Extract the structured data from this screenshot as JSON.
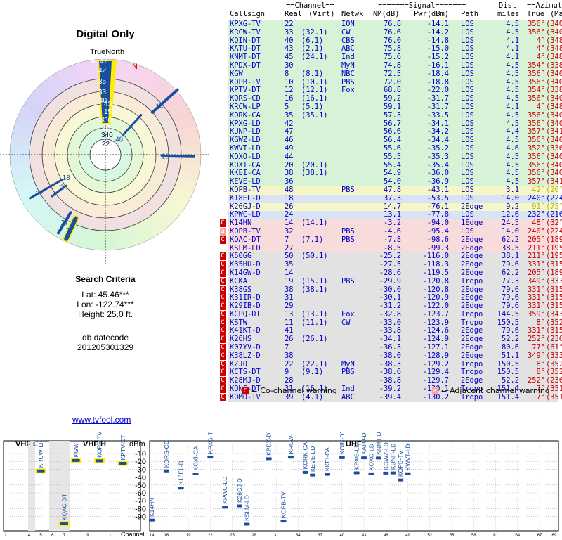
{
  "title": "Digital Only",
  "true_north_label": "TrueNorth",
  "magnetic_north_label": "N",
  "criteria": {
    "heading": "Search Criteria",
    "lat": "Lat: 45.46***",
    "lon": "Lon: -122.74***",
    "height": "Height: 25.0 ft.",
    "db_label": "db datecode",
    "db_value": "201205301329"
  },
  "link": "www.tvfool.com",
  "table": {
    "group_headers": {
      "channel": "==Channel==",
      "signal": "=======Signal=======",
      "dist": "Dist",
      "azimuth": "==Azimuth=="
    },
    "col_headers": {
      "callsign": "Callsign",
      "real": "Real",
      "virt": "(Virt)",
      "netwk": "Netwk",
      "nm": "NM(dB)",
      "pwr": "Pwr(dBm)",
      "path": "Path",
      "miles": "miles",
      "true": "True",
      "magn": "(Magn)"
    },
    "rows": [
      {
        "callsign": "KPXG-TV",
        "real": "22",
        "virt": "",
        "netwk": "ION",
        "nm": "76.8",
        "pwr": "-14.1",
        "path": "LOS",
        "dist": "4.5",
        "true": "356°",
        "magn": "(340°)",
        "color": "green",
        "warn": ""
      },
      {
        "callsign": "KRCW-TV",
        "real": "33",
        "virt": "(32.1)",
        "netwk": "CW",
        "nm": "76.6",
        "pwr": "-14.2",
        "path": "LOS",
        "dist": "4.5",
        "true": "356°",
        "magn": "(340°)",
        "color": "green",
        "warn": ""
      },
      {
        "callsign": "KOIN-DT",
        "real": "40",
        "virt": "(6.1)",
        "netwk": "CBS",
        "nm": "76.0",
        "pwr": "-14.8",
        "path": "LOS",
        "dist": "4.1",
        "true": "4°",
        "magn": "(348°)",
        "color": "green",
        "warn": ""
      },
      {
        "callsign": "KATU-DT",
        "real": "43",
        "virt": "(2.1)",
        "netwk": "ABC",
        "nm": "75.8",
        "pwr": "-15.0",
        "path": "LOS",
        "dist": "4.1",
        "true": "4°",
        "magn": "(348°)",
        "color": "green",
        "warn": ""
      },
      {
        "callsign": "KNMT-DT",
        "real": "45",
        "virt": "(24.1)",
        "netwk": "Ind",
        "nm": "75.6",
        "pwr": "-15.2",
        "path": "LOS",
        "dist": "4.1",
        "true": "4°",
        "magn": "(348°)",
        "color": "green",
        "warn": ""
      },
      {
        "callsign": "KPDX-DT",
        "real": "30",
        "virt": "",
        "netwk": "MyN",
        "nm": "74.8",
        "pwr": "-16.1",
        "path": "LOS",
        "dist": "4.5",
        "true": "354°",
        "magn": "(338°)",
        "color": "green",
        "warn": ""
      },
      {
        "callsign": "KGW",
        "real": "8",
        "virt": "(8.1)",
        "netwk": "NBC",
        "nm": "72.5",
        "pwr": "-18.4",
        "path": "LOS",
        "dist": "4.5",
        "true": "356°",
        "magn": "(340°)",
        "color": "green",
        "warn": ""
      },
      {
        "callsign": "KOPB-TV",
        "real": "10",
        "virt": "(10.1)",
        "netwk": "PBS",
        "nm": "72.0",
        "pwr": "-18.8",
        "path": "LOS",
        "dist": "4.5",
        "true": "356°",
        "magn": "(340°)",
        "color": "green",
        "warn": ""
      },
      {
        "callsign": "KPTV-DT",
        "real": "12",
        "virt": "(12.1)",
        "netwk": "Fox",
        "nm": "68.8",
        "pwr": "-22.0",
        "path": "LOS",
        "dist": "4.5",
        "true": "354°",
        "magn": "(338°)",
        "color": "green",
        "warn": ""
      },
      {
        "callsign": "KORS-CD",
        "real": "16",
        "virt": "(16.1)",
        "netwk": "",
        "nm": "59.2",
        "pwr": "-31.7",
        "path": "LOS",
        "dist": "4.5",
        "true": "356°",
        "magn": "(340°)",
        "color": "green",
        "warn": ""
      },
      {
        "callsign": "KRCW-LP",
        "real": "5",
        "virt": "(5.1)",
        "netwk": "",
        "nm": "59.1",
        "pwr": "-31.7",
        "path": "LOS",
        "dist": "4.1",
        "true": "4°",
        "magn": "(348°)",
        "color": "green",
        "warn": ""
      },
      {
        "callsign": "KORK-CA",
        "real": "35",
        "virt": "(35.1)",
        "netwk": "",
        "nm": "57.3",
        "pwr": "-33.5",
        "path": "LOS",
        "dist": "4.5",
        "true": "356°",
        "magn": "(340°)",
        "color": "green",
        "warn": ""
      },
      {
        "callsign": "KPXG-LD",
        "real": "42",
        "virt": "",
        "netwk": "",
        "nm": "56.7",
        "pwr": "-34.1",
        "path": "LOS",
        "dist": "4.5",
        "true": "356°",
        "magn": "(340°)",
        "color": "green",
        "warn": ""
      },
      {
        "callsign": "KUNP-LD",
        "real": "47",
        "virt": "",
        "netwk": "",
        "nm": "56.6",
        "pwr": "-34.2",
        "path": "LOS",
        "dist": "4.4",
        "true": "357°",
        "magn": "(341°)",
        "color": "green",
        "warn": ""
      },
      {
        "callsign": "KGWZ-LD",
        "real": "46",
        "virt": "",
        "netwk": "",
        "nm": "56.4",
        "pwr": "-34.4",
        "path": "LOS",
        "dist": "4.5",
        "true": "356°",
        "magn": "(340°)",
        "color": "green",
        "warn": ""
      },
      {
        "callsign": "KWVT-LD",
        "real": "49",
        "virt": "",
        "netwk": "",
        "nm": "55.6",
        "pwr": "-35.2",
        "path": "LOS",
        "dist": "4.6",
        "true": "352°",
        "magn": "(336°)",
        "color": "green",
        "warn": ""
      },
      {
        "callsign": "KOXO-LD",
        "real": "44",
        "virt": "",
        "netwk": "",
        "nm": "55.5",
        "pwr": "-35.3",
        "path": "LOS",
        "dist": "4.5",
        "true": "356°",
        "magn": "(340°)",
        "color": "green",
        "warn": ""
      },
      {
        "callsign": "KOXI-CA",
        "real": "20",
        "virt": "(20.1)",
        "netwk": "",
        "nm": "55.4",
        "pwr": "-35.4",
        "path": "LOS",
        "dist": "4.5",
        "true": "356°",
        "magn": "(340°)",
        "color": "green",
        "warn": ""
      },
      {
        "callsign": "KKEI-CA",
        "real": "38",
        "virt": "(38.1)",
        "netwk": "",
        "nm": "54.9",
        "pwr": "-36.0",
        "path": "LOS",
        "dist": "4.5",
        "true": "356°",
        "magn": "(340°)",
        "color": "green",
        "warn": ""
      },
      {
        "callsign": "KEVE-LD",
        "real": "36",
        "virt": "",
        "netwk": "",
        "nm": "54.0",
        "pwr": "-36.9",
        "path": "LOS",
        "dist": "4.5",
        "true": "357°",
        "magn": "(341°)",
        "color": "green",
        "warn": ""
      },
      {
        "callsign": "KOPB-TV",
        "real": "48",
        "virt": "",
        "netwk": "PBS",
        "nm": "47.8",
        "pwr": "-43.1",
        "path": "LOS",
        "dist": "3.1",
        "true": "42°",
        "magn": "(26°)",
        "color": "yellow",
        "warn": ""
      },
      {
        "callsign": "K18EL-D",
        "real": "18",
        "virt": "",
        "netwk": "",
        "nm": "37.3",
        "pwr": "-53.5",
        "path": "LOS",
        "dist": "14.0",
        "true": "240°",
        "magn": "(224°)",
        "color": "blue",
        "warn": ""
      },
      {
        "callsign": "K26GJ-D",
        "real": "26",
        "virt": "",
        "netwk": "",
        "nm": "14.7",
        "pwr": "-76.1",
        "path": "2Edge",
        "dist": "9.2",
        "true": "91°",
        "magn": "(75°)",
        "color": "yellow",
        "warn": ""
      },
      {
        "callsign": "KPWC-LD",
        "real": "24",
        "virt": "",
        "netwk": "",
        "nm": "13.1",
        "pwr": "-77.8",
        "path": "LOS",
        "dist": "12.6",
        "true": "232°",
        "magn": "(216°)",
        "color": "blue",
        "warn": ""
      },
      {
        "callsign": "K14HN",
        "real": "14",
        "virt": "(14.1)",
        "netwk": "",
        "nm": "-3.2",
        "pwr": "-94.0",
        "path": "1Edge",
        "dist": "24.5",
        "true": "48°",
        "magn": "(32°)",
        "color": "pink",
        "warn": "C"
      },
      {
        "callsign": "KOPB-TV",
        "real": "32",
        "virt": "",
        "netwk": "PBS",
        "nm": "-4.6",
        "pwr": "-95.4",
        "path": "LOS",
        "dist": "14.0",
        "true": "240°",
        "magn": "(224°)",
        "color": "pink",
        "warn": "a"
      },
      {
        "callsign": "KOAC-DT",
        "real": "7",
        "virt": "(7.1)",
        "netwk": "PBS",
        "nm": "-7.8",
        "pwr": "-98.6",
        "path": "2Edge",
        "dist": "62.2",
        "true": "205°",
        "magn": "(189°)",
        "color": "pink",
        "warn": "C"
      },
      {
        "callsign": "KSLM-LD",
        "real": "27",
        "virt": "",
        "netwk": "",
        "nm": "-8.5",
        "pwr": "-99.3",
        "path": "2Edge",
        "dist": "38.5",
        "true": "211°",
        "magn": "(195°)",
        "color": "pink",
        "warn": ""
      },
      {
        "callsign": "K50GG",
        "real": "50",
        "virt": "(50.1)",
        "netwk": "",
        "nm": "-25.2",
        "pwr": "-116.0",
        "path": "2Edge",
        "dist": "38.1",
        "true": "211°",
        "magn": "(195°)",
        "color": "gray",
        "warn": "C"
      },
      {
        "callsign": "K35HU-D",
        "real": "35",
        "virt": "",
        "netwk": "",
        "nm": "-27.5",
        "pwr": "-118.3",
        "path": "2Edge",
        "dist": "79.6",
        "true": "331°",
        "magn": "(315°)",
        "color": "gray",
        "warn": "C"
      },
      {
        "callsign": "K14GW-D",
        "real": "14",
        "virt": "",
        "netwk": "",
        "nm": "-28.6",
        "pwr": "-119.5",
        "path": "2Edge",
        "dist": "62.2",
        "true": "205°",
        "magn": "(189°)",
        "color": "gray",
        "warn": "C"
      },
      {
        "callsign": "KCKA",
        "real": "19",
        "virt": "(15.1)",
        "netwk": "PBS",
        "nm": "-29.9",
        "pwr": "-120.8",
        "path": "Tropo",
        "dist": "77.3",
        "true": "349°",
        "magn": "(333°)",
        "color": "gray",
        "warn": "C"
      },
      {
        "callsign": "K38GS",
        "real": "38",
        "virt": "(38.1)",
        "netwk": "",
        "nm": "-30.0",
        "pwr": "-120.8",
        "path": "2Edge",
        "dist": "79.6",
        "true": "331°",
        "magn": "(315°)",
        "color": "gray",
        "warn": "C"
      },
      {
        "callsign": "K31IR-D",
        "real": "31",
        "virt": "",
        "netwk": "",
        "nm": "-30.1",
        "pwr": "-120.9",
        "path": "2Edge",
        "dist": "79.6",
        "true": "331°",
        "magn": "(315°)",
        "color": "gray",
        "warn": "C"
      },
      {
        "callsign": "K29IB-D",
        "real": "29",
        "virt": "",
        "netwk": "",
        "nm": "-31.2",
        "pwr": "-122.0",
        "path": "2Edge",
        "dist": "79.6",
        "true": "331°",
        "magn": "(315°)",
        "color": "gray",
        "warn": "C"
      },
      {
        "callsign": "KCPQ-DT",
        "real": "13",
        "virt": "(13.1)",
        "netwk": "Fox",
        "nm": "-32.8",
        "pwr": "-123.7",
        "path": "Tropo",
        "dist": "144.5",
        "true": "359°",
        "magn": "(343°)",
        "color": "gray",
        "warn": "C"
      },
      {
        "callsign": "KSTW",
        "real": "11",
        "virt": "(11.1)",
        "netwk": "CW",
        "nm": "-33.0",
        "pwr": "-123.9",
        "path": "Tropo",
        "dist": "150.5",
        "true": "8°",
        "magn": "(352°)",
        "color": "gray",
        "warn": "C"
      },
      {
        "callsign": "K41KT-D",
        "real": "41",
        "virt": "",
        "netwk": "",
        "nm": "-33.8",
        "pwr": "-124.6",
        "path": "2Edge",
        "dist": "79.6",
        "true": "331°",
        "magn": "(315°)",
        "color": "gray",
        "warn": "C"
      },
      {
        "callsign": "K26HS",
        "real": "26",
        "virt": "(26.1)",
        "netwk": "",
        "nm": "-34.1",
        "pwr": "-124.9",
        "path": "2Edge",
        "dist": "52.2",
        "true": "252°",
        "magn": "(236°)",
        "color": "gray",
        "warn": "C"
      },
      {
        "callsign": "K07YV-D",
        "real": "7",
        "virt": "",
        "netwk": "",
        "nm": "-36.3",
        "pwr": "-127.1",
        "path": "2Edge",
        "dist": "80.6",
        "true": "77°",
        "magn": "(61°)",
        "color": "gray",
        "warn": "C"
      },
      {
        "callsign": "K38LZ-D",
        "real": "38",
        "virt": "",
        "netwk": "",
        "nm": "-38.0",
        "pwr": "-128.9",
        "path": "2Edge",
        "dist": "51.1",
        "true": "349°",
        "magn": "(333°)",
        "color": "gray",
        "warn": "C"
      },
      {
        "callsign": "KZJO",
        "real": "22",
        "virt": "(22.1)",
        "netwk": "MyN",
        "nm": "-38.3",
        "pwr": "-129.2",
        "path": "Tropo",
        "dist": "150.5",
        "true": "8°",
        "magn": "(352°)",
        "color": "gray",
        "warn": "C"
      },
      {
        "callsign": "KCTS-DT",
        "real": "9",
        "virt": "(9.1)",
        "netwk": "PBS",
        "nm": "-38.6",
        "pwr": "-129.4",
        "path": "Tropo",
        "dist": "150.5",
        "true": "8°",
        "magn": "(352°)",
        "color": "gray",
        "warn": "C"
      },
      {
        "callsign": "K28MJ-D",
        "real": "28",
        "virt": "",
        "netwk": "",
        "nm": "-38.8",
        "pwr": "-129.7",
        "path": "2Edge",
        "dist": "52.2",
        "true": "252°",
        "magn": "(236°)",
        "color": "gray",
        "warn": "C"
      },
      {
        "callsign": "KONG-DT",
        "real": "31",
        "virt": "(16.1)",
        "netwk": "Ind",
        "nm": "-39.2",
        "pwr": "-130.1",
        "path": "Tropo",
        "dist": "151.4",
        "true": "7°",
        "magn": "(351°)",
        "color": "gray",
        "warn": "C"
      },
      {
        "callsign": "KOMO-TV",
        "real": "39",
        "virt": "(4.1)",
        "netwk": "ABC",
        "nm": "-39.4",
        "pwr": "-130.2",
        "path": "Tropo",
        "dist": "151.4",
        "true": "7°",
        "magn": "(351°)",
        "color": "gray",
        "warn": "C"
      }
    ]
  },
  "legend": {
    "co": "= Co-channel warning",
    "adj": "= Adjacent channel warning",
    "co_icon": "C",
    "adj_icon": "a"
  },
  "spectrum": {
    "vhf_l": "VHF L",
    "vhf_h": "VHF H",
    "uhf": "UHF",
    "dbm": "dBm",
    "channel_label": "Channel",
    "db_ticks": [
      "-10",
      "-20",
      "-30",
      "-40",
      "-50",
      "-60",
      "-70",
      "-80",
      "-90"
    ],
    "vhf_ticks": [
      "2",
      "4",
      "5",
      "6",
      "7",
      "9",
      "11",
      "13"
    ],
    "uhf_ticks": [
      "14",
      "16",
      "19",
      "22",
      "25",
      "28",
      "31",
      "34",
      "37",
      "40",
      "43",
      "46",
      "49",
      "52",
      "55",
      "58",
      "61",
      "64",
      "67",
      "69"
    ],
    "stations": [
      {
        "name": "KRCW-LP",
        "ch": 5,
        "db": -31.7,
        "band": "vhf",
        "hl": true
      },
      {
        "name": "KGW",
        "ch": 8,
        "db": -18.4,
        "band": "vhf",
        "hl": true
      },
      {
        "name": "KOPB-TV",
        "ch": 10,
        "db": -18.8,
        "band": "vhf",
        "hl": true
      },
      {
        "name": "KPTV-DT",
        "ch": 12,
        "db": -22.0,
        "band": "vhf",
        "hl": true
      },
      {
        "name": "KOAC-DT",
        "ch": 7,
        "db": -98.6,
        "band": "vhf",
        "hl": true
      },
      {
        "name": "K14HN",
        "ch": 14,
        "db": -94.0,
        "band": "uhf"
      },
      {
        "name": "KORS-CD",
        "ch": 16,
        "db": -31.7,
        "band": "uhf"
      },
      {
        "name": "K18EL-D",
        "ch": 18,
        "db": -53.5,
        "band": "uhf"
      },
      {
        "name": "KOXI-CA",
        "ch": 20,
        "db": -35.4,
        "band": "uhf"
      },
      {
        "name": "KPXG-TV",
        "ch": 22,
        "db": -14.1,
        "band": "uhf"
      },
      {
        "name": "KPWC-LD",
        "ch": 24,
        "db": -77.8,
        "band": "uhf"
      },
      {
        "name": "K26GJ-D",
        "ch": 26,
        "db": -76.1,
        "band": "uhf"
      },
      {
        "name": "KSLM-LD",
        "ch": 27,
        "db": -99.3,
        "band": "uhf"
      },
      {
        "name": "KPDX-DT",
        "ch": 30,
        "db": -16.1,
        "band": "uhf"
      },
      {
        "name": "KOPB-TV",
        "ch": 32,
        "db": -95.4,
        "band": "uhf"
      },
      {
        "name": "KRCW-TV",
        "ch": 33,
        "db": -14.2,
        "band": "uhf"
      },
      {
        "name": "KORK-CA",
        "ch": 35,
        "db": -33.5,
        "band": "uhf"
      },
      {
        "name": "KEVE-LD",
        "ch": 36,
        "db": -36.9,
        "band": "uhf"
      },
      {
        "name": "KKEI-CA",
        "ch": 38,
        "db": -36.0,
        "band": "uhf"
      },
      {
        "name": "KOIN-DT",
        "ch": 40,
        "db": -14.8,
        "band": "uhf"
      },
      {
        "name": "KPXG-LD",
        "ch": 42,
        "db": -34.1,
        "band": "uhf"
      },
      {
        "name": "KATU-DT",
        "ch": 43,
        "db": -15.0,
        "band": "uhf"
      },
      {
        "name": "KOXO-LD",
        "ch": 44,
        "db": -35.3,
        "band": "uhf"
      },
      {
        "name": "KNMT-DT",
        "ch": 45,
        "db": -15.2,
        "band": "uhf"
      },
      {
        "name": "KGWZ-LD",
        "ch": 46,
        "db": -34.4,
        "band": "uhf"
      },
      {
        "name": "KUNP-LD",
        "ch": 47,
        "db": -34.2,
        "band": "uhf"
      },
      {
        "name": "KOPB-TV",
        "ch": 48,
        "db": -43.1,
        "band": "uhf"
      },
      {
        "name": "KWVT-LD",
        "ch": 49,
        "db": -35.2,
        "band": "uhf"
      }
    ]
  },
  "radar": {
    "labels_center": [
      "4",
      "47",
      "42",
      "35",
      "33",
      "40",
      "43",
      "45",
      "30",
      "8",
      "10",
      "12",
      "16",
      "15",
      "20",
      "38",
      "340",
      "22"
    ],
    "outer_labels": [
      "14",
      "48",
      "26",
      "18",
      "24",
      "32",
      "27",
      "7"
    ]
  }
}
